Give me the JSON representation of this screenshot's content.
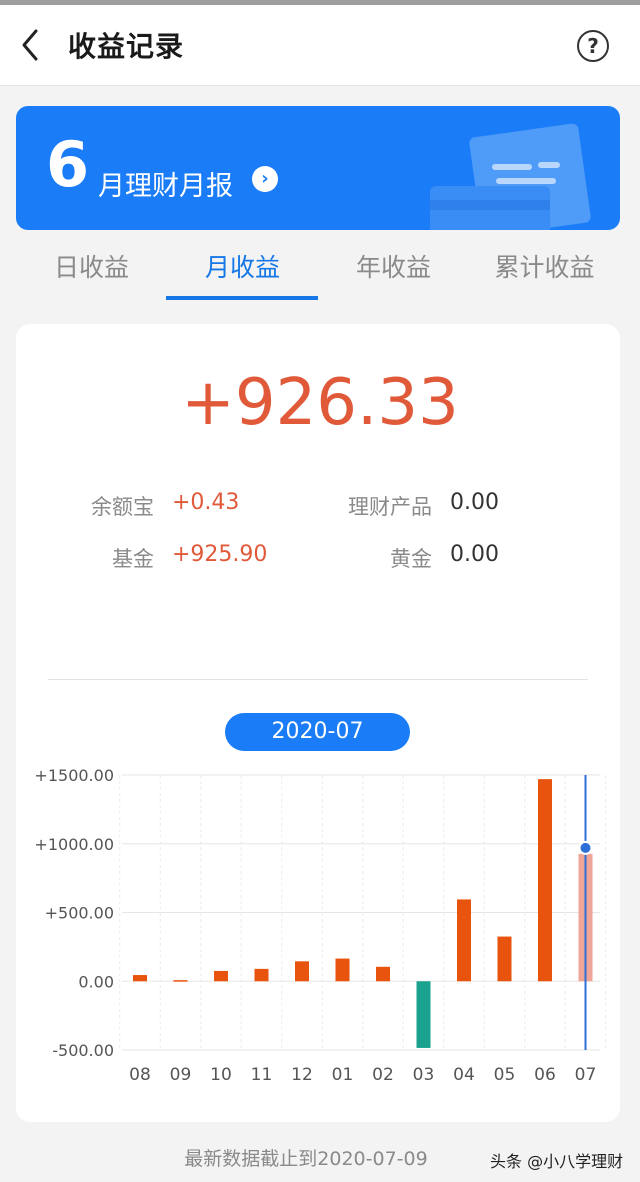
{
  "header": {
    "title": "收益记录",
    "help_symbol": "?"
  },
  "banner": {
    "month_number": "6",
    "title": "月理财月报"
  },
  "tabs": [
    {
      "label": "日收益",
      "active": false
    },
    {
      "label": "月收益",
      "active": true
    },
    {
      "label": "年收益",
      "active": false
    },
    {
      "label": "累计收益",
      "active": false
    }
  ],
  "summary": {
    "total": "+926.33",
    "items": [
      {
        "label": "余额宝",
        "value": "+0.43"
      },
      {
        "label": "理财产品",
        "value": "0.00"
      },
      {
        "label": "基金",
        "value": "+925.90"
      },
      {
        "label": "黄金",
        "value": "0.00"
      }
    ]
  },
  "chart_selector": {
    "label": "2020-07"
  },
  "chart_data": {
    "type": "bar",
    "categories": [
      "08",
      "09",
      "10",
      "11",
      "12",
      "01",
      "02",
      "03",
      "04",
      "05",
      "06",
      "07"
    ],
    "values": [
      45,
      8,
      75,
      90,
      145,
      165,
      105,
      -485,
      595,
      325,
      1470,
      926.33
    ],
    "selected_index": 11,
    "ylim": [
      -500,
      1500
    ],
    "yticks": [
      "+1500.00",
      "+1000.00",
      "+500.00",
      "0.00",
      "-500.00"
    ],
    "ytick_values": [
      1500,
      1000,
      500,
      0,
      -500
    ],
    "colors": {
      "positive": "#e8530e",
      "negative": "#1aa28f",
      "selected": "#efa696",
      "cursor": "#2d6fd6"
    }
  },
  "footer": {
    "note": "最新数据截止到2020-07-09"
  },
  "watermark": "头条 @小八学理财",
  "colors": {
    "accent": "#1a7cf6",
    "gain": "#e05a3a"
  }
}
